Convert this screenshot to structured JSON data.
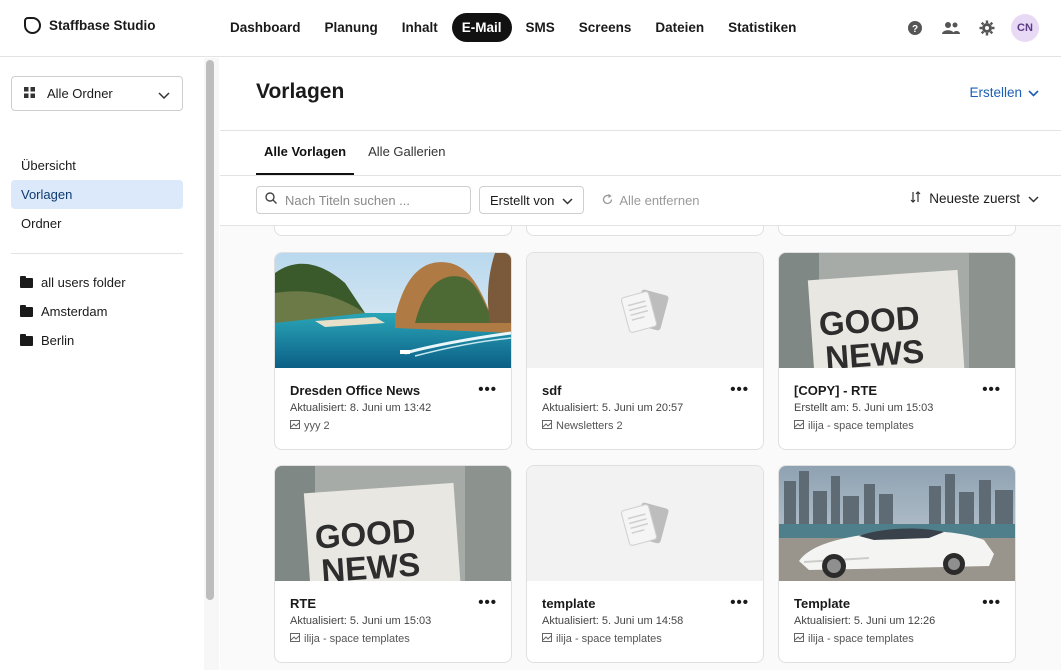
{
  "app": {
    "name": "Staffbase Studio"
  },
  "nav": {
    "items": [
      {
        "label": "Dashboard",
        "active": false
      },
      {
        "label": "Planung",
        "active": false
      },
      {
        "label": "Inhalt",
        "active": false
      },
      {
        "label": "E-Mail",
        "active": true
      },
      {
        "label": "SMS",
        "active": false
      },
      {
        "label": "Screens",
        "active": false
      },
      {
        "label": "Dateien",
        "active": false
      },
      {
        "label": "Statistiken",
        "active": false
      }
    ],
    "icons": [
      "help-icon",
      "users-icon",
      "gear-icon"
    ],
    "avatar_initials": "CN"
  },
  "sidebar": {
    "folder_select": "Alle Ordner",
    "items": [
      {
        "label": "Übersicht",
        "active": false
      },
      {
        "label": "Vorlagen",
        "active": true
      },
      {
        "label": "Ordner",
        "active": false
      }
    ],
    "folders": [
      "all users folder",
      "Amsterdam",
      "Berlin"
    ]
  },
  "main": {
    "title": "Vorlagen",
    "create_label": "Erstellen",
    "tabs": [
      {
        "label": "Alle Vorlagen",
        "active": true
      },
      {
        "label": "Alle Gallerien",
        "active": false
      }
    ],
    "search_placeholder": "Nach Titeln suchen ...",
    "created_by_label": "Erstellt von",
    "clear_all_label": "Alle entfernen",
    "sort_label": "Neueste zuerst"
  },
  "cards": [
    {
      "title": "Dresden Office News",
      "meta": "Aktualisiert: 8. Juni um 13:42",
      "folder": "yyy 2",
      "thumb": "island"
    },
    {
      "title": "sdf",
      "meta": "Aktualisiert: 5. Juni um 20:57",
      "folder": "Newsletters 2",
      "thumb": "placeholder"
    },
    {
      "title": "[COPY] - RTE",
      "meta": "Erstellt am: 5. Juni um 15:03",
      "folder": "ilija - space templates",
      "thumb": "goodnews"
    },
    {
      "title": "RTE",
      "meta": "Aktualisiert: 5. Juni um 15:03",
      "folder": "ilija - space templates",
      "thumb": "goodnews"
    },
    {
      "title": "template",
      "meta": "Aktualisiert: 5. Juni um 14:58",
      "folder": "ilija - space templates",
      "thumb": "placeholder"
    },
    {
      "title": "Template",
      "meta": "Aktualisiert: 5. Juni um 12:26",
      "folder": "ilija - space templates",
      "thumb": "car"
    }
  ],
  "thumb_text": {
    "goodnews_line1": "GOOD",
    "goodnews_line2": "NEWS"
  },
  "colors": {
    "accent": "#1c5fb5",
    "active_nav": "#111111",
    "sidebar_active": "#dbe9fb"
  }
}
